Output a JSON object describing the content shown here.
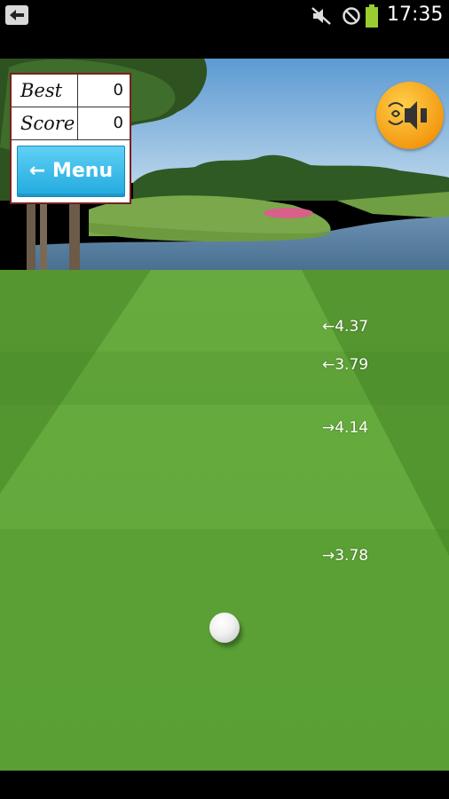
{
  "status_bar": {
    "time": "17:35"
  },
  "scoreboard": {
    "best_label": "Best",
    "best_value": "0",
    "score_label": "Score",
    "score_value": "0",
    "menu_label": "← Menu"
  },
  "sound_button": {
    "icon": "speaker-muted-icon"
  },
  "distance_markers": [
    "←4.37",
    "←3.79",
    "→4.14",
    "→3.78"
  ],
  "colors": {
    "sky": "#6fa8d6",
    "grass": "#5fa835",
    "menu_button": "#2ab2e4",
    "sound_button": "#f5a11a",
    "battery": "#9acd32"
  }
}
